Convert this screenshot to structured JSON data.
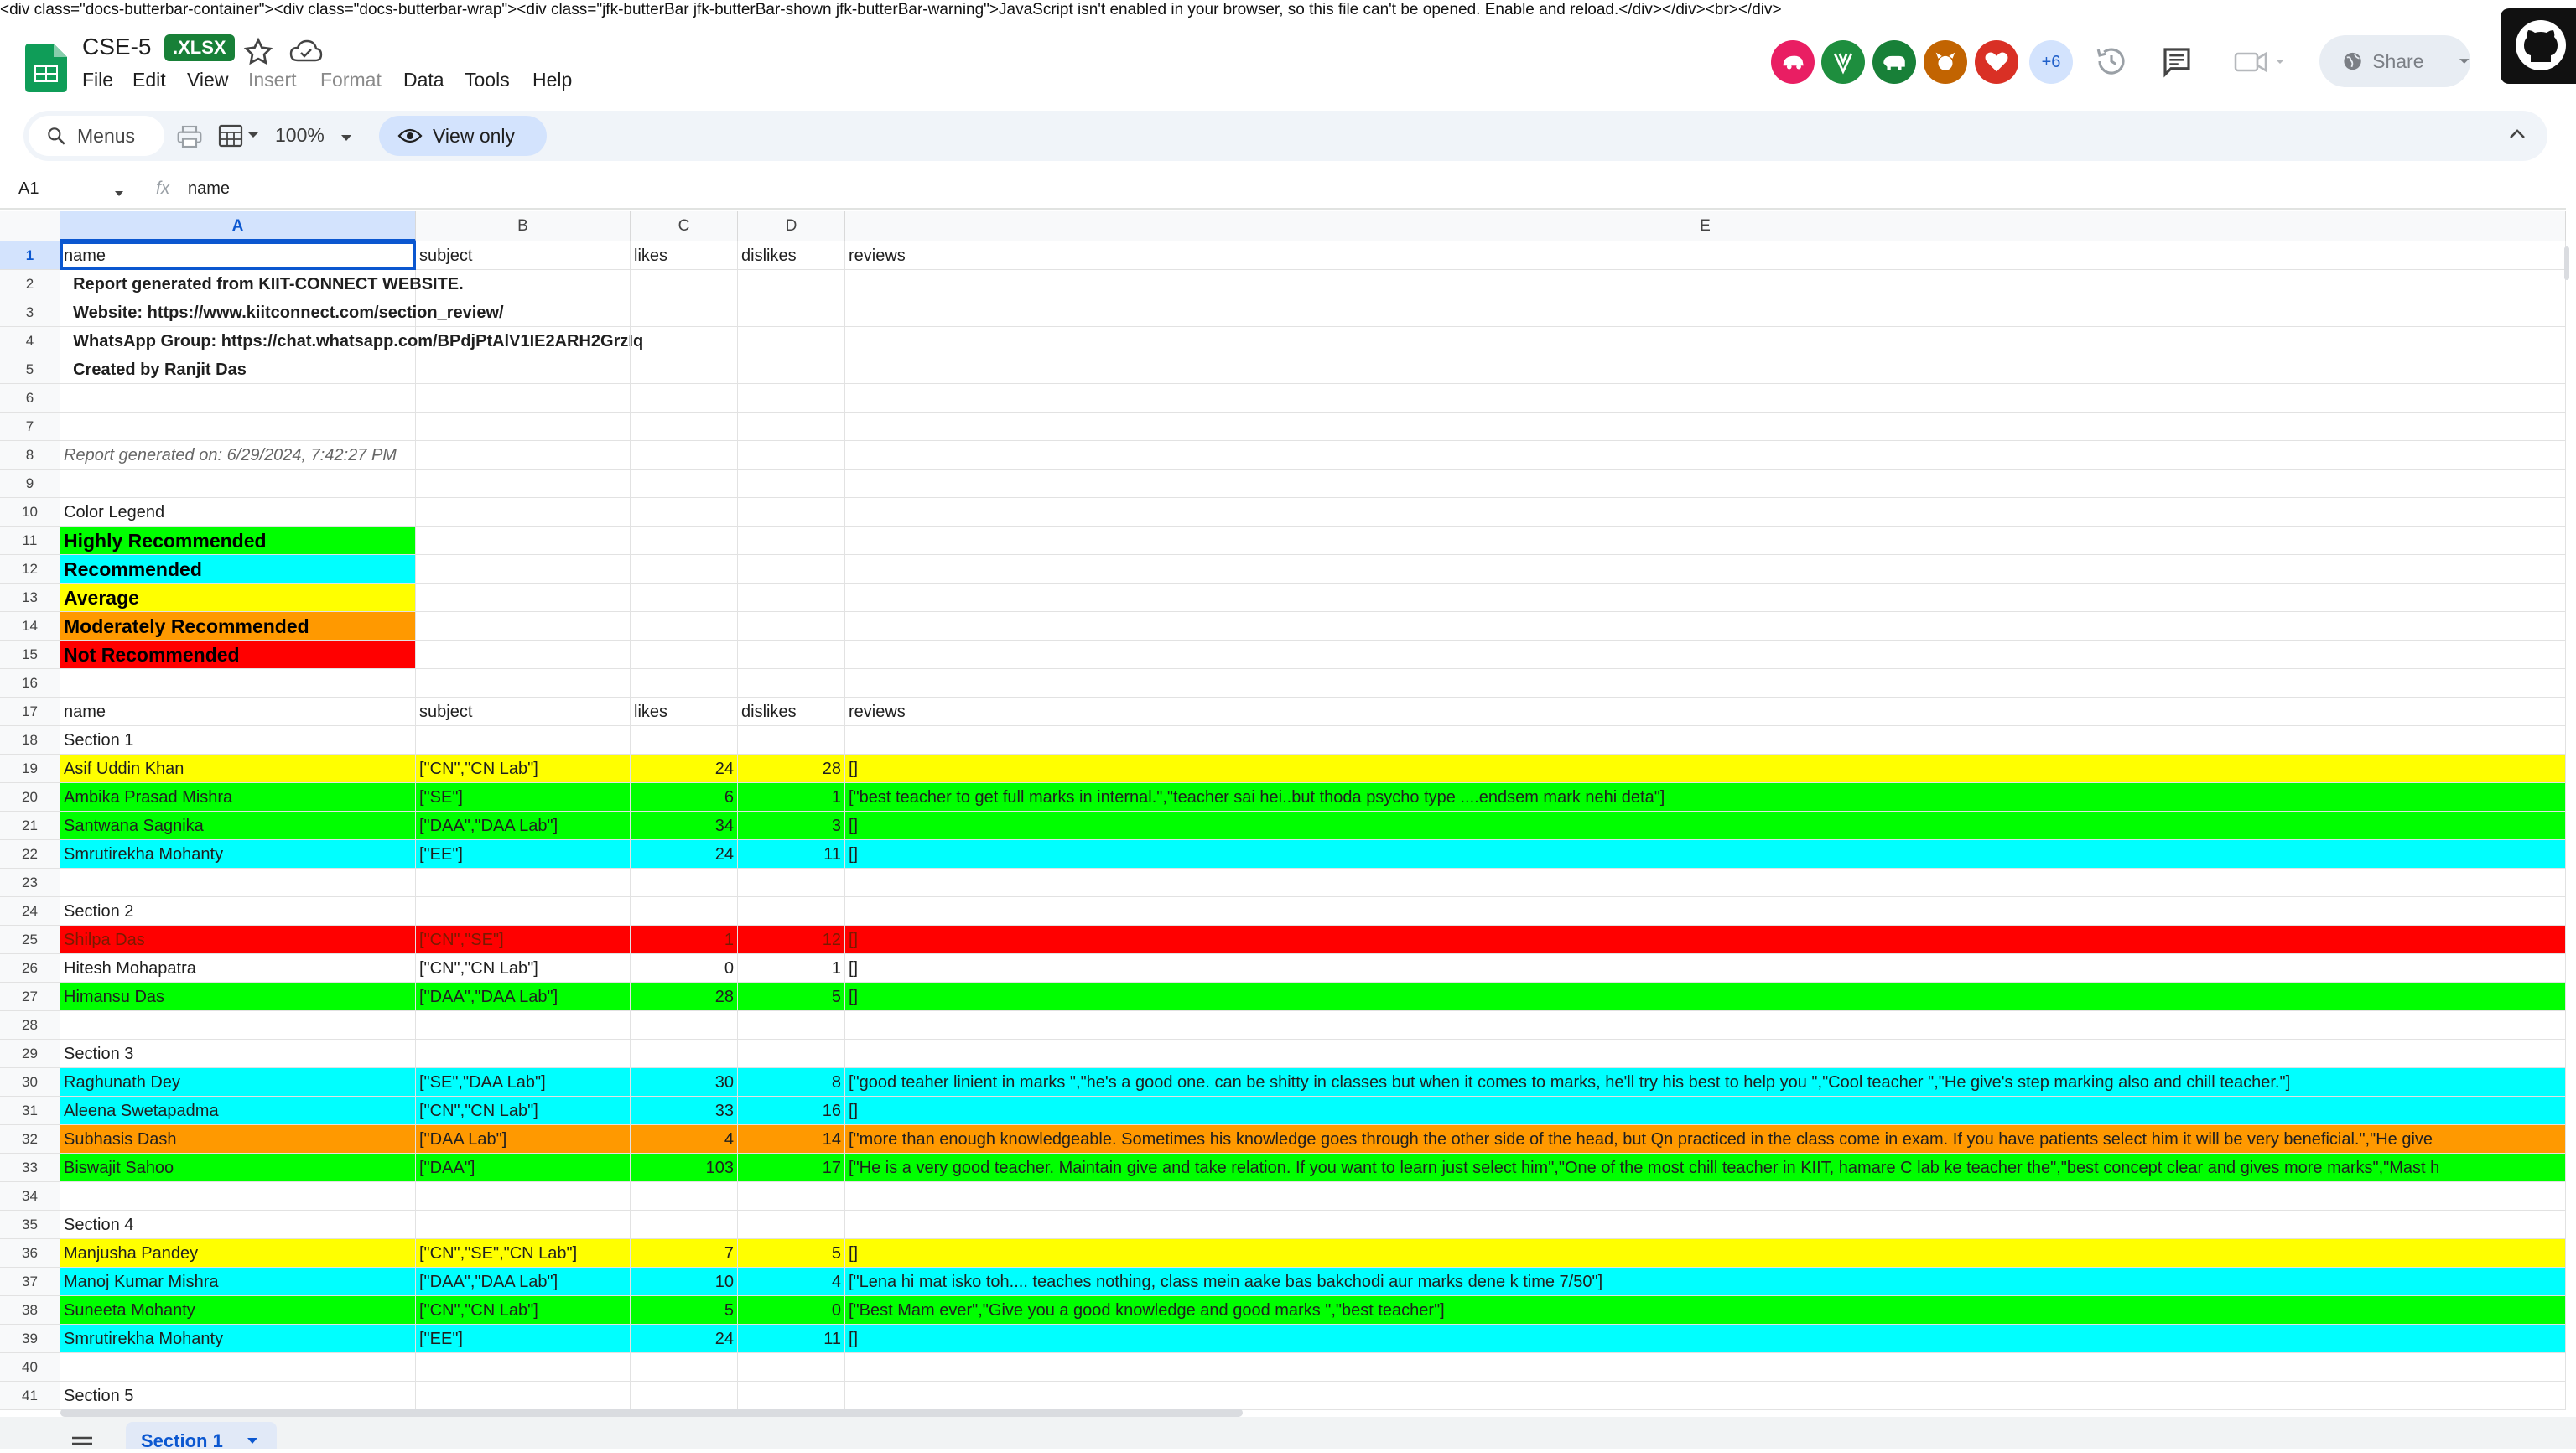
{
  "raw_html_line": "<div class=\"docs-butterbar-container\"><div class=\"docs-butterbar-wrap\"><div class=\"jfk-butterBar jfk-butterBar-shown jfk-butterBar-warning\">JavaScript isn't enabled in your browser, so this file can't be opened. Enable and reload.</div></div><br></div>",
  "header": {
    "title": "CSE-5",
    "badge": ".XLSX",
    "menu": [
      "File",
      "Edit",
      "View",
      "Insert",
      "Format",
      "Data",
      "Tools",
      "Help"
    ],
    "avatar_more": "+6",
    "share_label": "Share"
  },
  "toolbar": {
    "menus_label": "Menus",
    "zoom": "100%",
    "view_only_label": "View only"
  },
  "formula_bar": {
    "cell_ref": "A1",
    "fx": "fx",
    "value": "name"
  },
  "columns": [
    "A",
    "B",
    "C",
    "D",
    "E"
  ],
  "rows": [
    {
      "n": "1",
      "a": "name",
      "b": "subject",
      "c": "likes",
      "d": "dislikes",
      "e": "reviews",
      "bg": ""
    },
    {
      "n": "2",
      "a": "  Report generated from KIIT-CONNECT WEBSITE.",
      "b": "",
      "c": "",
      "d": "",
      "e": "",
      "bg": "",
      "style": "bold"
    },
    {
      "n": "3",
      "a": "  Website: https://www.kiitconnect.com/section_review/",
      "b": "",
      "c": "",
      "d": "",
      "e": "",
      "bg": "",
      "style": "bold"
    },
    {
      "n": "4",
      "a": "  WhatsApp Group: https://chat.whatsapp.com/BPdjPtAlV1IE2ARH2GrzIq",
      "b": "",
      "c": "",
      "d": "",
      "e": "",
      "bg": "",
      "style": "bold"
    },
    {
      "n": "5",
      "a": "  Created by Ranjit Das",
      "b": "",
      "c": "",
      "d": "",
      "e": "",
      "bg": "",
      "style": "bold"
    },
    {
      "n": "6",
      "a": "",
      "b": "",
      "c": "",
      "d": "",
      "e": "",
      "bg": ""
    },
    {
      "n": "7",
      "a": "",
      "b": "",
      "c": "",
      "d": "",
      "e": "",
      "bg": ""
    },
    {
      "n": "8",
      "a": "Report generated on: 6/29/2024, 7:42:27 PM",
      "b": "",
      "c": "",
      "d": "",
      "e": "",
      "bg": "",
      "style": "italic"
    },
    {
      "n": "9",
      "a": "",
      "b": "",
      "c": "",
      "d": "",
      "e": "",
      "bg": ""
    },
    {
      "n": "10",
      "a": "Color Legend",
      "b": "",
      "c": "",
      "d": "",
      "e": "",
      "bg": ""
    },
    {
      "n": "11",
      "a": "Highly Recommended",
      "b": "",
      "c": "",
      "d": "",
      "e": "",
      "bg": "",
      "legend": "#00ff00"
    },
    {
      "n": "12",
      "a": "Recommended",
      "b": "",
      "c": "",
      "d": "",
      "e": "",
      "bg": "",
      "legend": "#00ffff"
    },
    {
      "n": "13",
      "a": "Average",
      "b": "",
      "c": "",
      "d": "",
      "e": "",
      "bg": "",
      "legend": "#ffff00"
    },
    {
      "n": "14",
      "a": "Moderately Recommended",
      "b": "",
      "c": "",
      "d": "",
      "e": "",
      "bg": "",
      "legend": "#ff9900"
    },
    {
      "n": "15",
      "a": "Not Recommended",
      "b": "",
      "c": "",
      "d": "",
      "e": "",
      "bg": "",
      "legend": "#ff0000"
    },
    {
      "n": "16",
      "a": "",
      "b": "",
      "c": "",
      "d": "",
      "e": "",
      "bg": ""
    },
    {
      "n": "17",
      "a": "name",
      "b": "subject",
      "c": "likes",
      "d": "dislikes",
      "e": "reviews",
      "bg": ""
    },
    {
      "n": "18",
      "a": "Section 1",
      "b": "",
      "c": "",
      "d": "",
      "e": "",
      "bg": ""
    },
    {
      "n": "19",
      "a": "Asif Uddin Khan",
      "b": "[\"CN\",\"CN Lab\"]",
      "c": "24",
      "d": "28",
      "e": "[]",
      "bg": "#ffff00"
    },
    {
      "n": "20",
      "a": "Ambika Prasad Mishra",
      "b": "[\"SE\"]",
      "c": "6",
      "d": "1",
      "e": "[\"best teacher to get full marks in internal.\",\"teacher sai hei..but thoda psycho type ....endsem mark nehi deta\"]",
      "bg": "#00ff00"
    },
    {
      "n": "21",
      "a": "Santwana Sagnika",
      "b": "[\"DAA\",\"DAA Lab\"]",
      "c": "34",
      "d": "3",
      "e": "[]",
      "bg": "#00ff00"
    },
    {
      "n": "22",
      "a": "Smrutirekha Mohanty",
      "b": "[\"EE\"]",
      "c": "24",
      "d": "11",
      "e": "[]",
      "bg": "#00ffff"
    },
    {
      "n": "23",
      "a": "",
      "b": "",
      "c": "",
      "d": "",
      "e": "",
      "bg": ""
    },
    {
      "n": "24",
      "a": "Section 2",
      "b": "",
      "c": "",
      "d": "",
      "e": "",
      "bg": ""
    },
    {
      "n": "25",
      "a": "Shilpa Das",
      "b": "[\"CN\",\"SE\"]",
      "c": "1",
      "d": "12",
      "e": "[]",
      "bg": "#ff0000"
    },
    {
      "n": "26",
      "a": "Hitesh Mohapatra",
      "b": "[\"CN\",\"CN Lab\"]",
      "c": "0",
      "d": "1",
      "e": "[]",
      "bg": ""
    },
    {
      "n": "27",
      "a": "Himansu Das",
      "b": "[\"DAA\",\"DAA Lab\"]",
      "c": "28",
      "d": "5",
      "e": "[]",
      "bg": "#00ff00"
    },
    {
      "n": "28",
      "a": "",
      "b": "",
      "c": "",
      "d": "",
      "e": "",
      "bg": ""
    },
    {
      "n": "29",
      "a": "Section 3",
      "b": "",
      "c": "",
      "d": "",
      "e": "",
      "bg": ""
    },
    {
      "n": "30",
      "a": "Raghunath Dey",
      "b": "[\"SE\",\"DAA Lab\"]",
      "c": "30",
      "d": "8",
      "e": "[\"good teaher linient in marks \",\"he's a good one. can be shitty in classes but when it comes to marks, he'll try his best to help you \",\"Cool teacher \",\"He give's step marking also and chill teacher.\"]",
      "bg": "#00ffff"
    },
    {
      "n": "31",
      "a": "Aleena Swetapadma",
      "b": "[\"CN\",\"CN Lab\"]",
      "c": "33",
      "d": "16",
      "e": "[]",
      "bg": "#00ffff"
    },
    {
      "n": "32",
      "a": "Subhasis Dash",
      "b": "[\"DAA Lab\"]",
      "c": "4",
      "d": "14",
      "e": "[\"more than enough knowledgeable. Sometimes his knowledge goes through the other side of the head, but Qn practiced in the class come in exam. If you have patients  select him it will be very beneficial.\",\"He give",
      "bg": "#ff9900"
    },
    {
      "n": "33",
      "a": "Biswajit Sahoo",
      "b": "[\"DAA\"]",
      "c": "103",
      "d": "17",
      "e": "[\"He is a very good teacher. Maintain give and take relation. If you want to learn just select him\",\"One of the most chill teacher in KIIT, hamare C lab ke teacher the\",\"best concept clear and gives more marks\",\"Mast h",
      "bg": "#00ff00"
    },
    {
      "n": "34",
      "a": "",
      "b": "",
      "c": "",
      "d": "",
      "e": "",
      "bg": ""
    },
    {
      "n": "35",
      "a": "Section 4",
      "b": "",
      "c": "",
      "d": "",
      "e": "",
      "bg": ""
    },
    {
      "n": "36",
      "a": "Manjusha Pandey",
      "b": "[\"CN\",\"SE\",\"CN Lab\"]",
      "c": "7",
      "d": "5",
      "e": "[]",
      "bg": "#ffff00"
    },
    {
      "n": "37",
      "a": "Manoj Kumar Mishra",
      "b": "[\"DAA\",\"DAA Lab\"]",
      "c": "10",
      "d": "4",
      "e": "[\"Lena hi mat isko toh.... teaches nothing, class mein aake bas bakchodi aur marks dene k time 7/50\"]",
      "bg": "#00ffff"
    },
    {
      "n": "38",
      "a": "Suneeta Mohanty",
      "b": "[\"CN\",\"CN Lab\"]",
      "c": "5",
      "d": "0",
      "e": "[\"Best Mam ever\",\"Give you a good knowledge and good marks \",\"best teacher\"]",
      "bg": "#00ff00"
    },
    {
      "n": "39",
      "a": "Smrutirekha Mohanty",
      "b": "[\"EE\"]",
      "c": "24",
      "d": "11",
      "e": "[]",
      "bg": "#00ffff"
    },
    {
      "n": "40",
      "a": "",
      "b": "",
      "c": "",
      "d": "",
      "e": "",
      "bg": ""
    },
    {
      "n": "41",
      "a": "Section 5",
      "b": "",
      "c": "",
      "d": "",
      "e": "",
      "bg": ""
    }
  ],
  "sheet_tab": "Section 1",
  "colors": {
    "brand_green": "#188038",
    "accent_blue": "#0b57d0",
    "toolbar_bg": "#f0f4f9"
  }
}
